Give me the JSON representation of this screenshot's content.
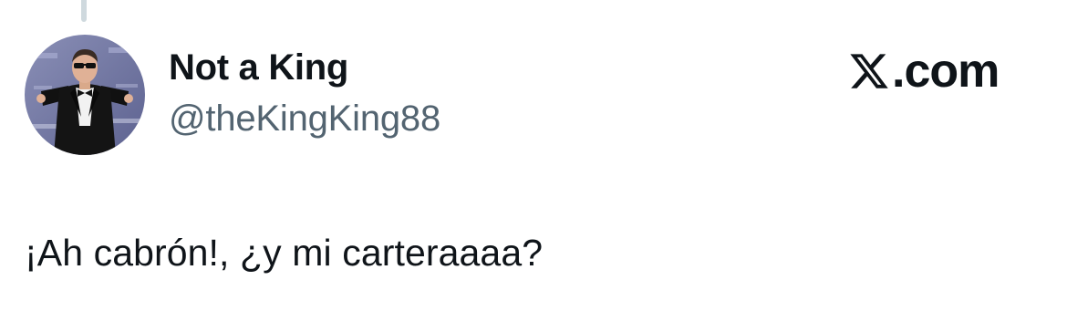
{
  "tweet": {
    "author": {
      "display_name": "Not a King",
      "handle": "@theKingKing88",
      "avatar": "avatar-photo-man-in-tuxedo-sunglasses"
    },
    "brand": {
      "text": ".com",
      "icon": "x-logo-icon",
      "color": "#0f1419"
    },
    "text": "¡Ah cabrón!, ¿y mi carteraaaa?"
  },
  "colors": {
    "primary_text": "#0f1419",
    "secondary_text": "#536471",
    "thread_line": "#cfd9de",
    "background": "#ffffff"
  }
}
